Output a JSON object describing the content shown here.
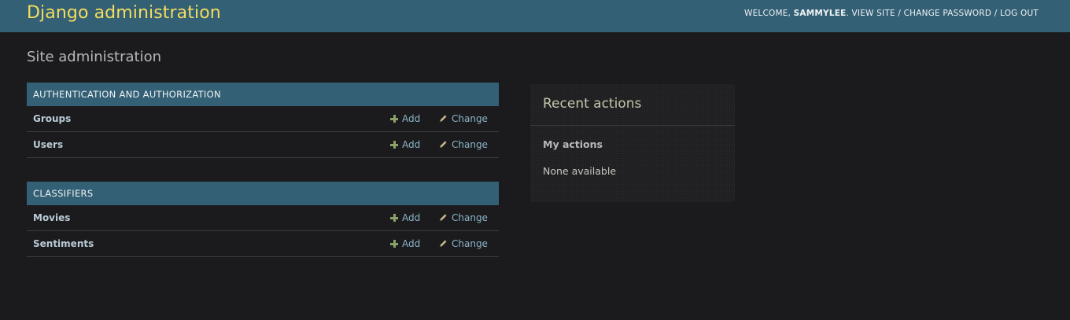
{
  "header": {
    "brand": "Django administration",
    "welcome_prefix": "WELCOME, ",
    "username": "SAMMYLEE",
    "welcome_suffix": ". ",
    "view_site": "VIEW SITE",
    "separator": " / ",
    "change_password": "CHANGE PASSWORD",
    "log_out": "LOG OUT"
  },
  "page": {
    "title": "Site administration"
  },
  "modules": [
    {
      "caption": "AUTHENTICATION AND AUTHORIZATION",
      "models": [
        {
          "name": "Groups",
          "add": "Add",
          "change": "Change"
        },
        {
          "name": "Users",
          "add": "Add",
          "change": "Change"
        }
      ]
    },
    {
      "caption": "CLASSIFIERS",
      "models": [
        {
          "name": "Movies",
          "add": "Add",
          "change": "Change"
        },
        {
          "name": "Sentiments",
          "add": "Add",
          "change": "Change"
        }
      ]
    }
  ],
  "recent_actions": {
    "title": "Recent actions",
    "subtitle": "My actions",
    "empty": "None available"
  },
  "icons": {
    "add": "plus-icon",
    "change": "pencil-icon"
  },
  "colors": {
    "header_bg": "#336075",
    "brand": "#f5dd5d",
    "page_bg": "#1b1b1d",
    "add_icon": "#8aa26a",
    "link": "#8ab4c8"
  }
}
